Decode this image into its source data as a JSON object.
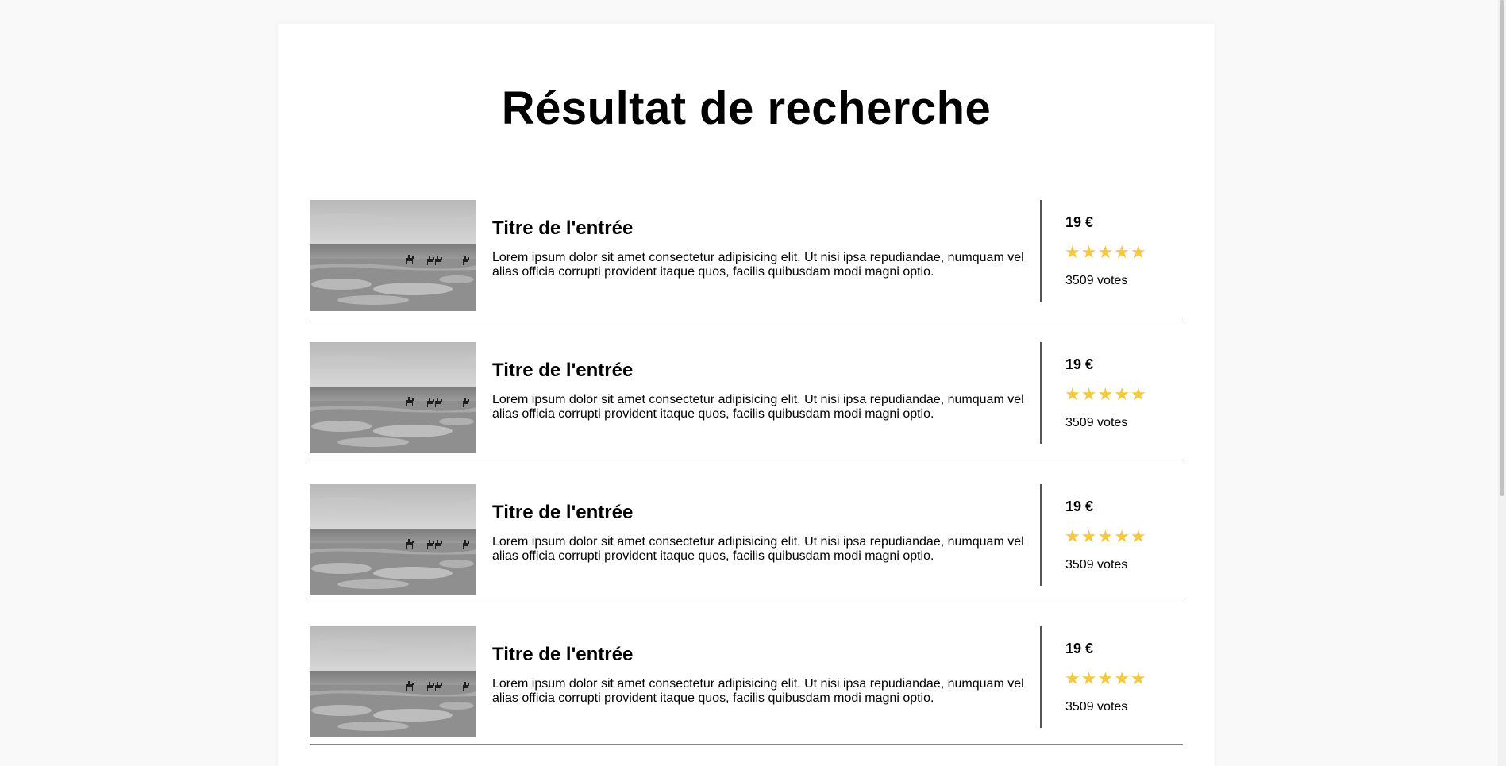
{
  "page": {
    "title": "Résultat de recherche"
  },
  "results": [
    {
      "image_alt": "horses-on-beach",
      "title": "Titre de l'entrée",
      "description": "Lorem ipsum dolor sit amet consectetur adipisicing elit. Ut nisi ipsa repudiandae, numquam vel alias officia corrupti provident itaque quos, facilis quibusdam modi magni optio.",
      "price": "19 €",
      "rating": 5,
      "rating_max": 5,
      "votes": "3509 votes"
    },
    {
      "image_alt": "horses-on-beach",
      "title": "Titre de l'entrée",
      "description": "Lorem ipsum dolor sit amet consectetur adipisicing elit. Ut nisi ipsa repudiandae, numquam vel alias officia corrupti provident itaque quos, facilis quibusdam modi magni optio.",
      "price": "19 €",
      "rating": 5,
      "rating_max": 5,
      "votes": "3509 votes"
    },
    {
      "image_alt": "horses-on-beach",
      "title": "Titre de l'entrée",
      "description": "Lorem ipsum dolor sit amet consectetur adipisicing elit. Ut nisi ipsa repudiandae, numquam vel alias officia corrupti provident itaque quos, facilis quibusdam modi magni optio.",
      "price": "19 €",
      "rating": 5,
      "rating_max": 5,
      "votes": "3509 votes"
    },
    {
      "image_alt": "horses-on-beach",
      "title": "Titre de l'entrée",
      "description": "Lorem ipsum dolor sit amet consectetur adipisicing elit. Ut nisi ipsa repudiandae, numquam vel alias officia corrupti provident itaque quos, facilis quibusdam modi magni optio.",
      "price": "19 €",
      "rating": 5,
      "rating_max": 5,
      "votes": "3509 votes"
    }
  ],
  "colors": {
    "star": "#f5c842",
    "divider": "#8a8a8a",
    "background": "#f9f9f9",
    "card": "#ffffff"
  },
  "icons": {
    "star": "star-icon"
  }
}
